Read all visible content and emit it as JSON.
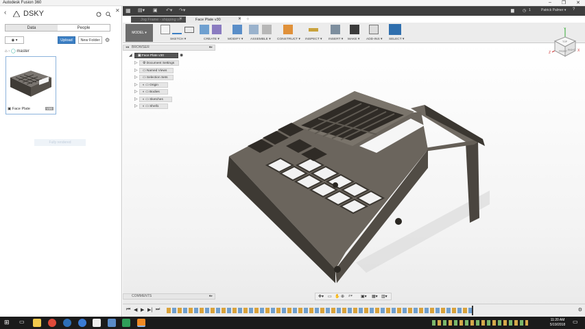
{
  "window": {
    "title": "Autodesk Fusion 360",
    "minimize": "–",
    "maximize": "❐",
    "close": "✕"
  },
  "data_panel": {
    "project": "DSKY",
    "tabs": [
      "Data",
      "People"
    ],
    "upload_label": "Upload",
    "new_folder_label": "New Folder",
    "branch": "master",
    "file_name": "Face Plate",
    "file_version": "V30",
    "ghost_text": "Fully rendered"
  },
  "tabs": [
    {
      "label": "Jog Frame - shipping v7",
      "active": false
    },
    {
      "label": "Face Plate v30",
      "active": true
    }
  ],
  "header_right": {
    "notification_count": "1",
    "user": "Patrick Palmer ▾",
    "help": "?"
  },
  "toolbar": {
    "workspace": "MODEL ▾",
    "groups": [
      "SKETCH ▾",
      "CREATE ▾",
      "MODIFY ▾",
      "ASSEMBLE ▾",
      "CONSTRUCT ▾",
      "INSPECT ▾",
      "INSERT ▾",
      "MAKE ▾",
      "ADD-INS ▾",
      "SELECT ▾"
    ]
  },
  "browser": {
    "header": "BROWSER",
    "root": "Face Plate v30",
    "items": [
      "Document Settings",
      "Named Views",
      "Selection Sets",
      "Origin",
      "Bodies",
      "Sketches",
      "Shell1"
    ]
  },
  "comments": {
    "header": "COMMENTS"
  },
  "viewcube": {
    "top": "TOP",
    "front": "FRONT",
    "right": "RIGHT",
    "axis_x": "X",
    "axis_y": "Y",
    "axis_z": "Z"
  },
  "taskbar": {
    "time": "11:20 AM",
    "date": "5/19/2018"
  },
  "colors": {
    "accent": "#3c7fc4",
    "model_fill": "#5e5850",
    "toolbar": "#ececec",
    "taskbar": "#1b1b1b"
  }
}
